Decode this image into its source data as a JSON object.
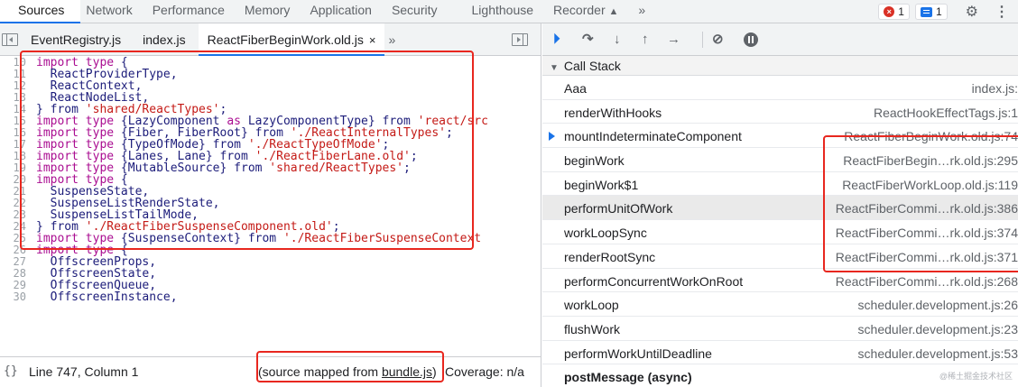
{
  "panel_tabs": [
    "Sources",
    "Network",
    "Performance",
    "Memory",
    "Application",
    "Security",
    "Lighthouse",
    "Recorder",
    "»"
  ],
  "badges": {
    "errors": "1",
    "messages": "1"
  },
  "file_tabs": [
    "EventRegistry.js",
    "index.js",
    "ReactFiberBeginWork.old.js"
  ],
  "file_tab_close": "×",
  "file_tab_more": "»",
  "code_lines": [
    {
      "n": "10",
      "t": [
        [
          "k",
          "import"
        ],
        [
          "p",
          " "
        ],
        [
          "k",
          "type"
        ],
        [
          "p",
          " {"
        ]
      ]
    },
    {
      "n": "11",
      "t": [
        [
          "p",
          "  ReactProviderType,"
        ]
      ]
    },
    {
      "n": "12",
      "t": [
        [
          "p",
          "  ReactContext,"
        ]
      ]
    },
    {
      "n": "13",
      "t": [
        [
          "p",
          "  ReactNodeList,"
        ]
      ]
    },
    {
      "n": "14",
      "t": [
        [
          "p",
          "} from "
        ],
        [
          "s",
          "'shared/ReactTypes'"
        ],
        [
          "p",
          ";"
        ]
      ]
    },
    {
      "n": "15",
      "t": [
        [
          "k",
          "import"
        ],
        [
          "p",
          " "
        ],
        [
          "k",
          "type"
        ],
        [
          "p",
          " {LazyComponent "
        ],
        [
          "k",
          "as"
        ],
        [
          "p",
          " LazyComponentType} from "
        ],
        [
          "s",
          "'react/src"
        ]
      ]
    },
    {
      "n": "16",
      "t": [
        [
          "k",
          "import"
        ],
        [
          "p",
          " "
        ],
        [
          "k",
          "type"
        ],
        [
          "p",
          " {Fiber, FiberRoot} from "
        ],
        [
          "s",
          "'./ReactInternalTypes'"
        ],
        [
          "p",
          ";"
        ]
      ]
    },
    {
      "n": "17",
      "t": [
        [
          "k",
          "import"
        ],
        [
          "p",
          " "
        ],
        [
          "k",
          "type"
        ],
        [
          "p",
          " {TypeOfMode} from "
        ],
        [
          "s",
          "'./ReactTypeOfMode'"
        ],
        [
          "p",
          ";"
        ]
      ]
    },
    {
      "n": "18",
      "t": [
        [
          "k",
          "import"
        ],
        [
          "p",
          " "
        ],
        [
          "k",
          "type"
        ],
        [
          "p",
          " {Lanes, Lane} from "
        ],
        [
          "s",
          "'./ReactFiberLane.old'"
        ],
        [
          "p",
          ";"
        ]
      ]
    },
    {
      "n": "19",
      "t": [
        [
          "k",
          "import"
        ],
        [
          "p",
          " "
        ],
        [
          "k",
          "type"
        ],
        [
          "p",
          " {MutableSource} from "
        ],
        [
          "s",
          "'shared/ReactTypes'"
        ],
        [
          "p",
          ";"
        ]
      ]
    },
    {
      "n": "20",
      "t": [
        [
          "k",
          "import"
        ],
        [
          "p",
          " "
        ],
        [
          "k",
          "type"
        ],
        [
          "p",
          " {"
        ]
      ]
    },
    {
      "n": "21",
      "t": [
        [
          "p",
          "  SuspenseState,"
        ]
      ]
    },
    {
      "n": "22",
      "t": [
        [
          "p",
          "  SuspenseListRenderState,"
        ]
      ]
    },
    {
      "n": "23",
      "t": [
        [
          "p",
          "  SuspenseListTailMode,"
        ]
      ]
    },
    {
      "n": "24",
      "t": [
        [
          "p",
          "} from "
        ],
        [
          "s",
          "'./ReactFiberSuspenseComponent.old'"
        ],
        [
          "p",
          ";"
        ]
      ]
    },
    {
      "n": "25",
      "t": [
        [
          "k",
          "import"
        ],
        [
          "p",
          " "
        ],
        [
          "k",
          "type"
        ],
        [
          "p",
          " {SuspenseContext} from "
        ],
        [
          "s",
          "'./ReactFiberSuspenseContext"
        ]
      ]
    },
    {
      "n": "26",
      "t": [
        [
          "k",
          "import"
        ],
        [
          "p",
          " "
        ],
        [
          "k",
          "type"
        ],
        [
          "p",
          " {"
        ]
      ]
    },
    {
      "n": "27",
      "t": [
        [
          "p",
          "  OffscreenProps,"
        ]
      ]
    },
    {
      "n": "28",
      "t": [
        [
          "p",
          "  OffscreenState,"
        ]
      ]
    },
    {
      "n": "29",
      "t": [
        [
          "p",
          "  OffscreenQueue,"
        ]
      ]
    },
    {
      "n": "30",
      "t": [
        [
          "p",
          "  OffscreenInstance,"
        ]
      ]
    }
  ],
  "status": {
    "braces": "{}",
    "position": "Line 747, Column 1",
    "mapped_prefix": "(source mapped from ",
    "mapped_link": "bundle.js",
    "mapped_suffix": ")",
    "coverage": "Coverage: n/a"
  },
  "call_stack": {
    "header": "Call Stack",
    "frames": [
      {
        "fn": "Aaa",
        "loc": "index.js:"
      },
      {
        "fn": "renderWithHooks",
        "loc": "ReactHookEffectTags.js:1"
      },
      {
        "fn": "mountIndeterminateComponent",
        "loc": "ReactFiberBeginWork.old.js:74",
        "current": true
      },
      {
        "fn": "beginWork",
        "loc": "ReactFiberBegin…rk.old.js:295"
      },
      {
        "fn": "beginWork$1",
        "loc": "ReactFiberWorkLoop.old.js:119"
      },
      {
        "fn": "performUnitOfWork",
        "loc": "ReactFiberCommi…rk.old.js:386",
        "highlight": true
      },
      {
        "fn": "workLoopSync",
        "loc": "ReactFiberCommi…rk.old.js:374"
      },
      {
        "fn": "renderRootSync",
        "loc": "ReactFiberCommi…rk.old.js:371"
      },
      {
        "fn": "performConcurrentWorkOnRoot",
        "loc": "ReactFiberCommi…rk.old.js:268"
      },
      {
        "fn": "workLoop",
        "loc": "scheduler.development.js:26"
      },
      {
        "fn": "flushWork",
        "loc": "scheduler.development.js:23"
      },
      {
        "fn": "performWorkUntilDeadline",
        "loc": "scheduler.development.js:53"
      }
    ],
    "async_label": "postMessage (async)"
  },
  "watermark": "@稀土掘金技术社区",
  "colors": {
    "accent": "#1a73e8",
    "annotation": "#e8271f",
    "keyword": "#aa0d91",
    "string": "#c41a16"
  }
}
